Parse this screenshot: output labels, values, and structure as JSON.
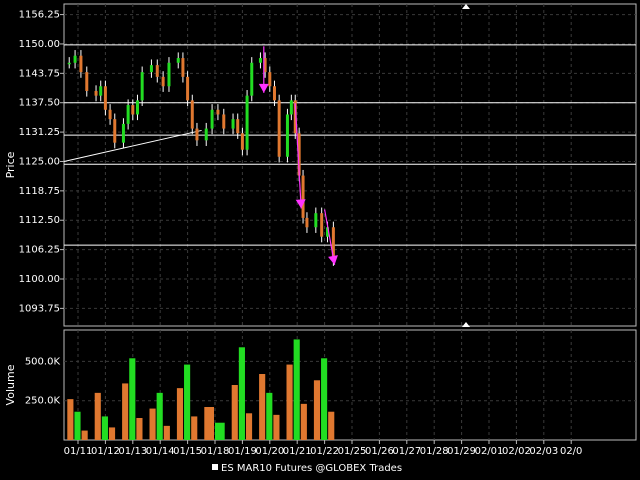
{
  "chart_data": {
    "type": "candlestick",
    "legend": "ES MAR10 Futures @GLOBEX Trades",
    "price_panel": {
      "ylabel": "Price",
      "ylim": [
        1090.0,
        1158.5
      ],
      "ticks": [
        "1156.25",
        "1150.00",
        "1143.75",
        "1137.50",
        "1131.25",
        "1125.00",
        "1118.75",
        "1112.50",
        "1106.25",
        "1100.00",
        "1093.75"
      ],
      "tick_values": [
        1156.25,
        1150.0,
        1143.75,
        1137.5,
        1131.25,
        1125.0,
        1118.75,
        1112.5,
        1106.25,
        1100.0,
        1093.75
      ],
      "horizontal_levels": [
        1149.8,
        1137.5,
        1130.6,
        1124.4,
        1107.2
      ],
      "trendline": {
        "x": [
          "01/11",
          "01/15"
        ],
        "y": [
          1125.0,
          1131.6
        ]
      },
      "arrows": [
        {
          "from": [
            "01/20",
            1149.5
          ],
          "to": [
            "01/20",
            1139.6
          ]
        },
        {
          "from": [
            "01/21",
            1137.4
          ],
          "to": [
            "01/21",
            1115.0
          ]
        },
        {
          "from": [
            "01/22",
            1114.8
          ],
          "to": [
            "01/22",
            1103.0
          ]
        }
      ],
      "series": [
        {
          "name": "Price",
          "points": [
            [
              "01/11",
              1146.0
            ],
            [
              "01/11",
              1147.5
            ],
            [
              "01/11",
              1144.0
            ],
            [
              "01/11",
              1140.0
            ],
            [
              "01/12",
              1139.0
            ],
            [
              "01/12",
              1141.0
            ],
            [
              "01/12",
              1136.0
            ],
            [
              "01/12",
              1134.0
            ],
            [
              "01/12",
              1129.0
            ],
            [
              "01/13",
              1133.0
            ],
            [
              "01/13",
              1137.0
            ],
            [
              "01/13",
              1135.0
            ],
            [
              "01/13",
              1138.0
            ],
            [
              "01/13",
              1144.0
            ],
            [
              "01/14",
              1145.5
            ],
            [
              "01/14",
              1143.0
            ],
            [
              "01/14",
              1141.0
            ],
            [
              "01/14",
              1146.0
            ],
            [
              "01/15",
              1147.0
            ],
            [
              "01/15",
              1143.0
            ],
            [
              "01/15",
              1138.0
            ],
            [
              "01/15",
              1132.0
            ],
            [
              "01/15",
              1129.5
            ],
            [
              "01/18",
              1132.0
            ],
            [
              "01/18",
              1136.0
            ],
            [
              "01/18",
              1135.0
            ],
            [
              "01/18",
              1132.0
            ],
            [
              "01/19",
              1134.0
            ],
            [
              "01/19",
              1131.0
            ],
            [
              "01/19",
              1127.5
            ],
            [
              "01/19",
              1139.0
            ],
            [
              "01/19",
              1146.0
            ],
            [
              "01/20",
              1147.0
            ],
            [
              "01/20",
              1144.0
            ],
            [
              "01/20",
              1141.0
            ],
            [
              "01/20",
              1138.0
            ],
            [
              "01/20",
              1126.0
            ],
            [
              "01/21",
              1135.0
            ],
            [
              "01/21",
              1138.0
            ],
            [
              "01/21",
              1131.0
            ],
            [
              "01/21",
              1122.0
            ],
            [
              "01/21",
              1113.0
            ],
            [
              "01/21",
              1111.0
            ],
            [
              "01/22",
              1114.0
            ],
            [
              "01/22",
              1109.0
            ],
            [
              "01/22",
              1111.0
            ],
            [
              "01/22",
              1104.0
            ]
          ]
        }
      ]
    },
    "volume_panel": {
      "ylabel": "Volume",
      "ticks": [
        "500.0K",
        "250.0K"
      ],
      "tick_values": [
        500000,
        250000
      ],
      "ylim": [
        0,
        700000
      ],
      "series": [
        {
          "name": "Volume",
          "points": [
            [
              "01/11",
              260000
            ],
            [
              "01/11",
              180000
            ],
            [
              "01/11",
              60000
            ],
            [
              "01/12",
              300000
            ],
            [
              "01/12",
              150000
            ],
            [
              "01/12",
              80000
            ],
            [
              "01/13",
              360000
            ],
            [
              "01/13",
              520000
            ],
            [
              "01/13",
              140000
            ],
            [
              "01/14",
              200000
            ],
            [
              "01/14",
              300000
            ],
            [
              "01/14",
              90000
            ],
            [
              "01/15",
              330000
            ],
            [
              "01/15",
              480000
            ],
            [
              "01/15",
              150000
            ],
            [
              "01/18",
              210000
            ],
            [
              "01/18",
              110000
            ],
            [
              "01/19",
              350000
            ],
            [
              "01/19",
              590000
            ],
            [
              "01/19",
              170000
            ],
            [
              "01/20",
              420000
            ],
            [
              "01/20",
              300000
            ],
            [
              "01/20",
              160000
            ],
            [
              "01/21",
              480000
            ],
            [
              "01/21",
              640000
            ],
            [
              "01/21",
              230000
            ],
            [
              "01/22",
              380000
            ],
            [
              "01/22",
              520000
            ],
            [
              "01/22",
              180000
            ]
          ]
        }
      ]
    },
    "x_axis": {
      "ticks": [
        "01/11",
        "01/12",
        "01/13",
        "01/14",
        "01/15",
        "01/18",
        "01/19",
        "01/20",
        "01/21",
        "01/22",
        "01/25",
        "01/26",
        "01/27",
        "01/28",
        "01/29",
        "02/01",
        "02/02",
        "02/03",
        "02/0"
      ],
      "tick_text": [
        "01/11",
        "01/12",
        "01/13",
        "01/14",
        "01/15",
        "01/18",
        "01/19",
        "01/20",
        "01/21",
        "01/22",
        "01/25",
        "01/26",
        "01/27",
        "01/28",
        "01/29",
        "02/01",
        "02/02",
        "02/03",
        "02/0"
      ]
    },
    "colors": {
      "background": "#000000",
      "grid": "#3a3a3a",
      "level_line": "#ffffff",
      "up": "#22dd22",
      "down": "#e07830",
      "annotation": "#ff33ff"
    },
    "grid": true
  }
}
